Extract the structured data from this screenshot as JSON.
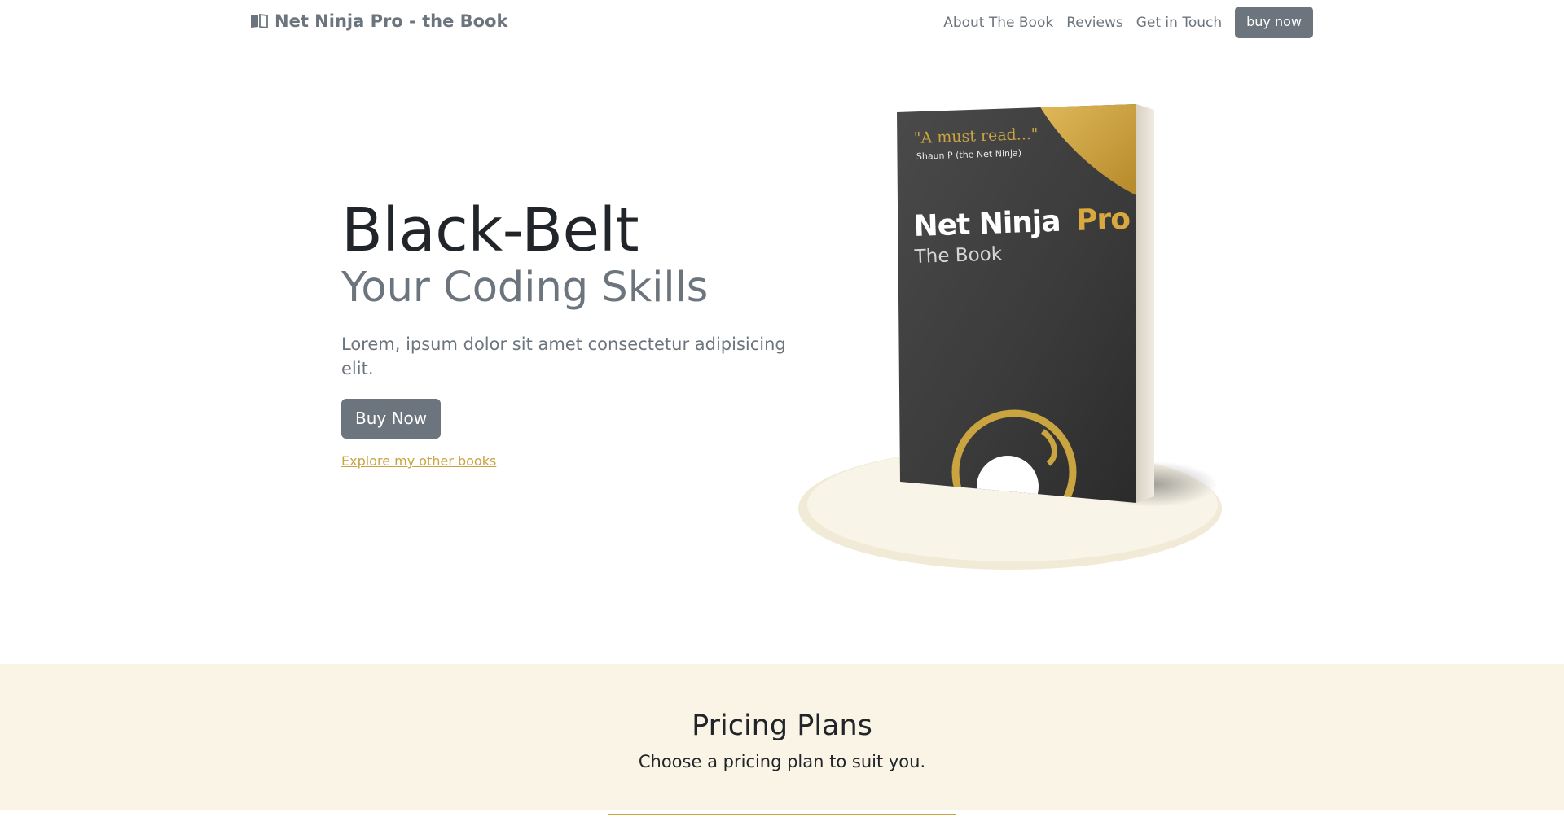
{
  "navbar": {
    "brand_icon": "open-book-icon",
    "brand": "Net Ninja Pro - the Book",
    "links": [
      "About The Book",
      "Reviews",
      "Get in Touch"
    ],
    "cta": "buy now"
  },
  "hero": {
    "title": "Black-Belt",
    "subtitle": "Your Coding Skills",
    "lead": "Lorem, ipsum dolor sit amet consectetur adipisicing elit.",
    "button": "Buy Now",
    "link": "Explore my other books"
  },
  "book": {
    "quote": "\"A must read...\"",
    "quote_author": "Shaun P (the Net Ninja)",
    "title_white": "Net Ninja",
    "title_gold": "Pro",
    "subtitle": "The Book"
  },
  "pricing": {
    "title": "Pricing Plans",
    "subtitle": "Choose a pricing plan to suit you."
  },
  "colors": {
    "secondary": "#6c757d",
    "gold": "#c9a441",
    "cream": "#f9f4e5",
    "cover_dark": "#3a3a3a"
  }
}
